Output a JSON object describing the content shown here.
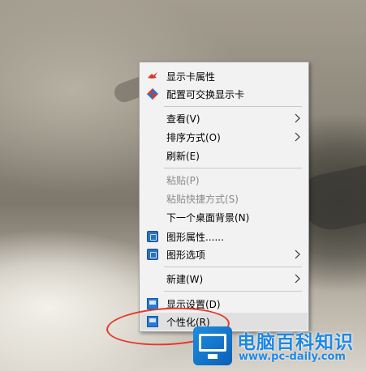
{
  "menu": {
    "items": [
      {
        "label": "显示卡属性",
        "icon": "graphics-card-icon",
        "disabled": false,
        "submenu": false
      },
      {
        "label": "配置可交换显示卡",
        "icon": "switchable-graphics-icon",
        "disabled": false,
        "submenu": false
      },
      {
        "label": "查看(V)",
        "icon": "",
        "disabled": false,
        "submenu": true
      },
      {
        "label": "排序方式(O)",
        "icon": "",
        "disabled": false,
        "submenu": true
      },
      {
        "label": "刷新(E)",
        "icon": "",
        "disabled": false,
        "submenu": false
      },
      {
        "label": "粘贴(P)",
        "icon": "",
        "disabled": true,
        "submenu": false
      },
      {
        "label": "粘贴快捷方式(S)",
        "icon": "",
        "disabled": true,
        "submenu": false
      },
      {
        "label": "下一个桌面背景(N)",
        "icon": "",
        "disabled": false,
        "submenu": false
      },
      {
        "label": "图形属性......",
        "icon": "intel-graphics-icon",
        "disabled": false,
        "submenu": false
      },
      {
        "label": "图形选项",
        "icon": "intel-graphics-icon",
        "disabled": false,
        "submenu": true
      },
      {
        "label": "新建(W)",
        "icon": "",
        "disabled": false,
        "submenu": true
      },
      {
        "label": "显示设置(D)",
        "icon": "display-monitor-icon",
        "disabled": false,
        "submenu": false
      },
      {
        "label": "个性化(R)",
        "icon": "personalize-monitor-icon",
        "disabled": false,
        "submenu": false,
        "highlighted": true
      }
    ]
  },
  "watermark": {
    "title": "电脑百科知识",
    "url": "www.pc-daily.com"
  },
  "colors": {
    "annotation": "#e23a2a",
    "watermark": "#1e88e5"
  }
}
